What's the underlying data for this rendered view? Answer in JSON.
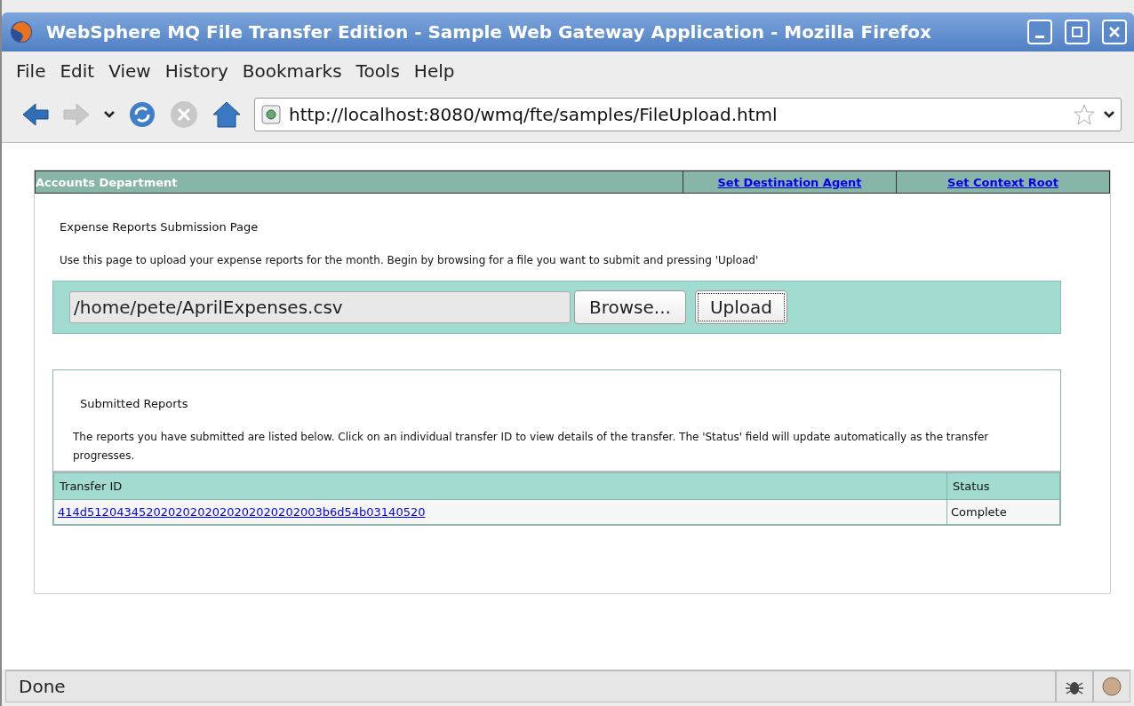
{
  "window": {
    "title": "WebSphere MQ File Transfer Edition - Sample Web Gateway Application - Mozilla Firefox"
  },
  "menu": [
    "File",
    "Edit",
    "View",
    "History",
    "Bookmarks",
    "Tools",
    "Help"
  ],
  "toolbar": {
    "back_disabled": false,
    "forward_disabled": true,
    "stop_disabled": true,
    "url": "http://localhost:8080/wmq/fte/samples/FileUpload.html"
  },
  "header": {
    "title": "Accounts Department",
    "links": [
      "Set Destination Agent",
      "Set Context Root"
    ]
  },
  "upload": {
    "heading": "Expense Reports Submission Page",
    "intro": "Use this page to upload your expense reports for the month. Begin by browsing for a file you want to submit and pressing 'Upload'",
    "file_value": "/home/pete/AprilExpenses.csv",
    "browse_button": "Browse...",
    "upload_button": "Upload"
  },
  "reports": {
    "heading": "Submitted Reports",
    "intro": "The reports you have submitted are listed below. Click on an individual transfer ID to view details of the transfer. The 'Status' field will update automatically as the transfer progresses.",
    "columns": [
      "Transfer ID",
      "Status"
    ],
    "rows": [
      {
        "transfer_id": "414d51204345202020202020202020202003b6d54b03140520",
        "status": "Complete"
      }
    ]
  },
  "status_bar": {
    "text": "Done"
  }
}
